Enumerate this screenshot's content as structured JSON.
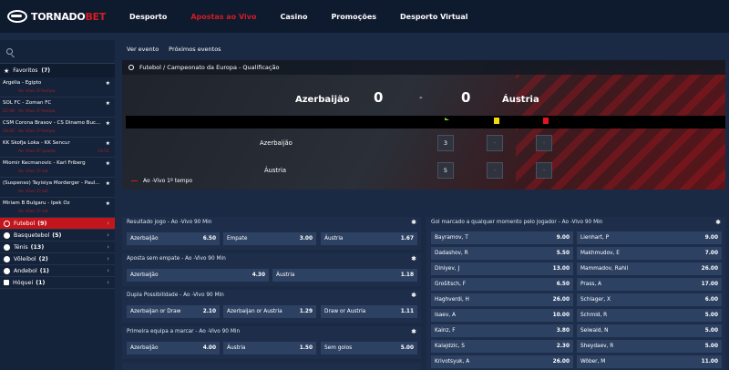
{
  "brand": {
    "name_a": "TORNADO",
    "name_b": "BET"
  },
  "nav": [
    "Desporto",
    "Apostas ao Vivo",
    "Casino",
    "Promoções",
    "Desporto Virtual"
  ],
  "favorites": {
    "label": "Favoritos",
    "count": "(7)",
    "items": [
      {
        "title": "Argélia - Egipto",
        "status": "Ao -Vivo 1º tempo",
        "score": ""
      },
      {
        "title": "SOL FC - Zoman FC",
        "status": "Ao -Vivo 1º tempo",
        "score": "22:46"
      },
      {
        "title": "CSM Corona Brasov - CS Dinamo Buc...",
        "status": "Ao -Vivo 1º tempo",
        "score": "18:42"
      },
      {
        "title": "KK Skofja Loka - KK Šencur",
        "status": "Ao -Vivo 2º quarto",
        "score": "13:51"
      },
      {
        "title": "Miomir Kecmanovic - Karl Friberg",
        "status": "Ao -Vivo 1º set",
        "score": ""
      },
      {
        "title": "(Suspenso) Tayisiya Morderger - Paul...",
        "status": "Ao -Vivo 1º set",
        "score": ""
      },
      {
        "title": "Miriam B Bulgaru - Ipek Oz",
        "status": "Ao -Vivo 1º set",
        "score": ""
      }
    ]
  },
  "sports": [
    {
      "name": "Futebol",
      "count": "(9)"
    },
    {
      "name": "Basquetebol",
      "count": "(5)"
    },
    {
      "name": "Ténis",
      "count": "(13)"
    },
    {
      "name": "Vôleibol",
      "count": "(2)"
    },
    {
      "name": "Andebol",
      "count": "(1)"
    },
    {
      "name": "Hóquei",
      "count": "(1)"
    }
  ],
  "tabs": [
    "Ver evento",
    "Próximos eventos"
  ],
  "match": {
    "competition": "Futebol / Campeonato da Europa - Qualificação",
    "home": "Azerbaijão",
    "away": "Áustria",
    "home_score": "0",
    "away_score": "0",
    "sep": "-",
    "home_corners": "3",
    "away_corners": "5",
    "placeholder": "-",
    "status": "Ao -Vivo 1º tempo"
  },
  "colors": {
    "accent": "#d21d22",
    "corner_flag": "#7ed321",
    "yellow": "#f5d90a",
    "red": "#e3141b"
  },
  "markets": [
    {
      "title": "Resultado jogo - Ao -Vivo 90 Min",
      "odds": [
        [
          "Azerbaijão",
          "6.50"
        ],
        [
          "Empate",
          "3.00"
        ],
        [
          "Áustria",
          "1.67"
        ]
      ]
    },
    {
      "title": "Aposta sem empate - Ao -Vivo 90 Min",
      "odds": [
        [
          "Azerbaijão",
          "4.30"
        ],
        [
          "Áustria",
          "1.18"
        ]
      ]
    },
    {
      "title": "Dupla Possibilidade - Ao -Vivo 90 Min",
      "odds": [
        [
          "Azerbaijan or Draw",
          "2.10"
        ],
        [
          "Azerbaijan or Austria",
          "1.29"
        ],
        [
          "Draw or Austria",
          "1.11"
        ]
      ]
    },
    {
      "title": "Primeira equipa a marcar - Ao -Vivo 90 Min",
      "odds": [
        [
          "Azerbaijão",
          "4.00"
        ],
        [
          "Áustria",
          "1.50"
        ],
        [
          "Sem golos",
          "5.00"
        ]
      ]
    }
  ],
  "scorer": {
    "title": "Gol marcado a qualquer momento pelo jogador - Ao -Vivo 90 Min",
    "rows": [
      [
        [
          "Bayramov, T",
          "9.00"
        ],
        [
          "Lienhart, P",
          "9.00"
        ]
      ],
      [
        [
          "Dadashov, R",
          "5.50"
        ],
        [
          "Makhmudov, E",
          "7.00"
        ]
      ],
      [
        [
          "Diniyev, J",
          "13.00"
        ],
        [
          "Mammadov, Rahil",
          "26.00"
        ]
      ],
      [
        [
          "Grošitsch, F",
          "6.50"
        ],
        [
          "Prass, A",
          "17.00"
        ]
      ],
      [
        [
          "Haghverdi, H",
          "26.00"
        ],
        [
          "Schlager, X",
          "6.00"
        ]
      ],
      [
        [
          "Isaev, A",
          "10.00"
        ],
        [
          "Schmid, R",
          "5.00"
        ]
      ],
      [
        [
          "Kainz, F",
          "3.80"
        ],
        [
          "Seiwald, N",
          "5.00"
        ]
      ],
      [
        [
          "Kalajdzic, S",
          "2.30"
        ],
        [
          "Sheydaev, R",
          "5.00"
        ]
      ],
      [
        [
          "Krivotsyuk, A",
          "26.00"
        ],
        [
          "Wöber, M",
          "11.00"
        ]
      ]
    ]
  }
}
